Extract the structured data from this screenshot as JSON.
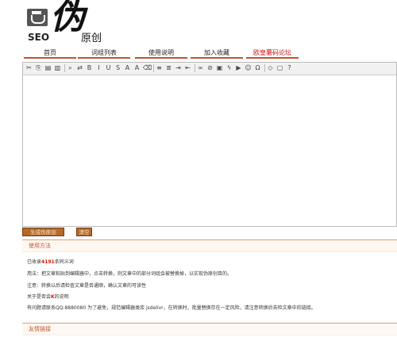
{
  "logo": {
    "seo": "SEO",
    "big": "伪",
    "small": "原创"
  },
  "nav": [
    {
      "label": "首页",
      "highlight": false
    },
    {
      "label": "词组列表",
      "highlight": false
    },
    {
      "label": "使用说明",
      "highlight": false
    },
    {
      "label": "加入收藏",
      "highlight": false
    },
    {
      "label": "欧皇薯码论坛",
      "highlight": true
    }
  ],
  "toolbar_icons": [
    "cut-icon",
    "copy-icon",
    "paste-icon",
    "paste-text-icon",
    "sep",
    "find-icon",
    "replace-icon",
    "bold-icon",
    "italic-icon",
    "underline-icon",
    "strike-icon",
    "font-color-icon",
    "bg-color-icon",
    "remove-format-icon",
    "sep",
    "align-left-icon",
    "align-center-icon",
    "indent-icon",
    "outdent-icon",
    "sep",
    "link-icon",
    "unlink-icon",
    "image-icon",
    "flash-icon",
    "media-icon",
    "emoticon-icon",
    "special-char-icon",
    "sep",
    "source-icon",
    "preview-icon",
    "help-icon"
  ],
  "toolbar_glyphs": {
    "cut-icon": "✂",
    "copy-icon": "⎘",
    "paste-icon": "▤",
    "paste-text-icon": "▥",
    "find-icon": "⌕",
    "replace-icon": "⇄",
    "bold-icon": "B",
    "italic-icon": "I",
    "underline-icon": "U",
    "strike-icon": "S",
    "font-color-icon": "A",
    "bg-color-icon": "A",
    "remove-format-icon": "⌫",
    "align-left-icon": "≡",
    "align-center-icon": "≣",
    "indent-icon": "⇥",
    "outdent-icon": "⇤",
    "link-icon": "∞",
    "unlink-icon": "⊘",
    "image-icon": "▣",
    "flash-icon": "ϟ",
    "media-icon": "▶",
    "emoticon-icon": "☺",
    "special-char-icon": "Ω",
    "source-icon": "◇",
    "preview-icon": "▢",
    "help-icon": "?"
  },
  "buttons": {
    "generate": "生成伪原创",
    "clear": "清空"
  },
  "info": {
    "title": "使用方法",
    "line1_prefix": "已收录",
    "line1_count": "4191",
    "line1_suffix": "条同义词",
    "line2": "用法：把文章粘贴到编辑器中，点击转换，则文章中的部分词组会被替换掉，以实现伪原创目的。",
    "line3": "注意：转换以后请检查文章是否通顺，确认文章的可读性",
    "line4_prefix": "关于是否会",
    "line4_highlight": "K",
    "line4_suffix": "的说明",
    "line5": "有问题请联系QQ:8880080 为了避免，规范编辑器类库 jsdelivr，在转换时，批量替换存在一定风险，请注意转换后去检文章中的链接。"
  },
  "friends": {
    "title": "友情链接"
  }
}
